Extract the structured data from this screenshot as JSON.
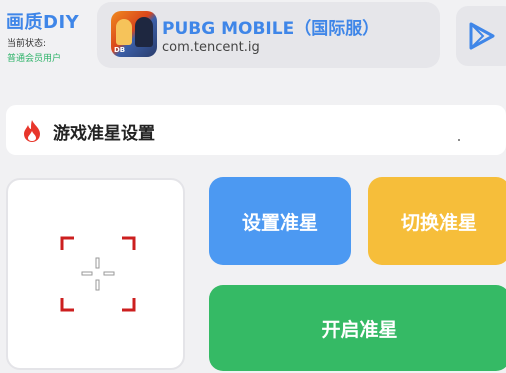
{
  "header": {
    "brand": "画质DIY",
    "status_label": "当前状态:",
    "status_value": "普通会员用户"
  },
  "app": {
    "name": "PUBG MOBILE（国际服）",
    "package": "com.tencent.ig",
    "icon": "pubg-app-icon"
  },
  "play_button": {
    "icon": "play-triangle-icon"
  },
  "section": {
    "title": "游戏准星设置",
    "icon": "fire-icon"
  },
  "crosshair_preview": {
    "icon": "crosshair-icon"
  },
  "buttons": {
    "set": "设置准星",
    "switch": "切换准星",
    "start": "开启准星"
  },
  "colors": {
    "brand_blue": "#3f86e8",
    "status_green": "#2fb36a",
    "set_button": "#4c99f2",
    "switch_button": "#f6be3a",
    "start_button": "#35ba65",
    "crosshair_red": "#cc1f1f",
    "fire_red": "#e8362b"
  }
}
